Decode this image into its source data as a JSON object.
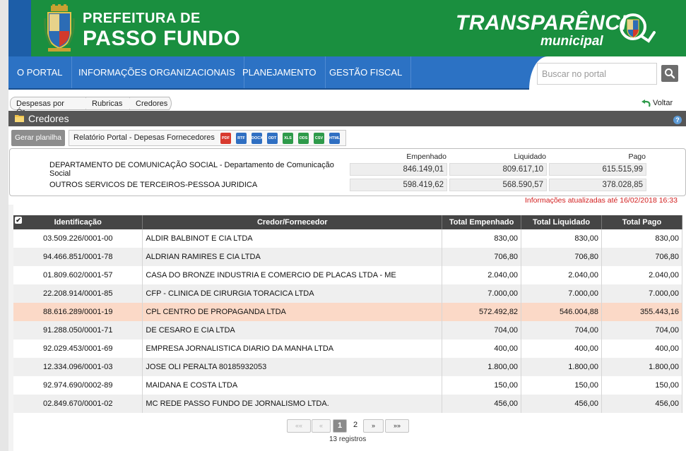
{
  "header": {
    "city_line1": "PREFEITURA DE",
    "city_line2": "PASSO FUNDO",
    "brand_line1": "TRANSPARÊNCI",
    "brand_line2": "municipal",
    "colors": {
      "green": "#1a8f3f",
      "blue": "#1d5ea8",
      "nav": "#2c72c4"
    }
  },
  "nav": {
    "items": [
      "O PORTAL",
      "INFORMAÇÕES ORGANIZACIONAIS",
      "PLANEJAMENTO",
      "GESTÃO FISCAL"
    ],
    "search_placeholder": "Buscar no portal",
    "search_icon": "search-icon"
  },
  "breadcrumb": {
    "items": [
      "Despesas por Ór...",
      "Rubricas",
      "Credores"
    ],
    "back_label": "Voltar"
  },
  "panel": {
    "title": "Credores",
    "help_icon": "help-icon"
  },
  "toolbar": {
    "generate_label": "Gerar planilha",
    "report_label": "Relatório Portal - Depesas Fornecedores",
    "formats": [
      {
        "label": "PDF",
        "color": "#d83a2e"
      },
      {
        "label": "RTF",
        "color": "#2f6fc2"
      },
      {
        "label": "DOCX",
        "color": "#2f6fc2"
      },
      {
        "label": "ODT",
        "color": "#2f6fc2"
      },
      {
        "label": "XLS",
        "color": "#2e9a4a"
      },
      {
        "label": "ODS",
        "color": "#2e9a4a"
      },
      {
        "label": "CSV",
        "color": "#2e9a4a"
      },
      {
        "label": "HTML",
        "color": "#2f6fc2"
      }
    ]
  },
  "summary": {
    "headers": [
      "Empenhado",
      "Liquidado",
      "Pago"
    ],
    "rows": [
      {
        "label": "DEPARTAMENTO DE COMUNICAÇÃO SOCIAL - Departamento de Comunicação Social",
        "empenhado": "846.149,01",
        "liquidado": "809.617,10",
        "pago": "615.515,99"
      },
      {
        "label": "OUTROS SERVICOS DE TERCEIROS-PESSOA JURIDICA",
        "empenhado": "598.419,62",
        "liquidado": "568.590,57",
        "pago": "378.028,85"
      }
    ],
    "updated": "Informações atualizadas até 16/02/2018 16:33"
  },
  "table": {
    "columns": [
      "Identificação",
      "Credor/Fornecedor",
      "Total Empenhado",
      "Total Liquidado",
      "Total Pago"
    ],
    "rows": [
      {
        "id": "03.509.226/0001-00",
        "name": "ALDIR BALBINOT E CIA LTDA",
        "emp": "830,00",
        "liq": "830,00",
        "pago": "830,00"
      },
      {
        "id": "94.466.851/0001-78",
        "name": "ALDRIAN RAMIRES E CIA LTDA",
        "emp": "706,80",
        "liq": "706,80",
        "pago": "706,80"
      },
      {
        "id": "01.809.602/0001-57",
        "name": "CASA DO BRONZE INDUSTRIA E COMERCIO DE PLACAS LTDA - ME",
        "emp": "2.040,00",
        "liq": "2.040,00",
        "pago": "2.040,00"
      },
      {
        "id": "22.208.914/0001-85",
        "name": "CFP - CLINICA DE CIRURGIA TORACICA LTDA",
        "emp": "7.000,00",
        "liq": "7.000,00",
        "pago": "7.000,00"
      },
      {
        "id": "88.616.289/0001-19",
        "name": "CPL CENTRO DE PROPAGANDA LTDA",
        "emp": "572.492,82",
        "liq": "546.004,88",
        "pago": "355.443,16"
      },
      {
        "id": "91.288.050/0001-71",
        "name": "DE CESARO E CIA LTDA",
        "emp": "704,00",
        "liq": "704,00",
        "pago": "704,00"
      },
      {
        "id": "92.029.453/0001-69",
        "name": "EMPRESA JORNALISTICA DIARIO DA MANHA LTDA",
        "emp": "400,00",
        "liq": "400,00",
        "pago": "400,00"
      },
      {
        "id": "12.334.096/0001-03",
        "name": "JOSE OLI PERALTA 80185932053",
        "emp": "1.800,00",
        "liq": "1.800,00",
        "pago": "1.800,00"
      },
      {
        "id": "92.974.690/0002-89",
        "name": "MAIDANA E COSTA LTDA",
        "emp": "150,00",
        "liq": "150,00",
        "pago": "150,00"
      },
      {
        "id": "02.849.670/0001-02",
        "name": "MC REDE PASSO FUNDO DE JORNALISMO LTDA.",
        "emp": "456,00",
        "liq": "456,00",
        "pago": "456,00"
      }
    ]
  },
  "pagination": {
    "first": "««",
    "prev": "«",
    "current": "1",
    "page2": "2",
    "next": "»",
    "last": "»»",
    "count": "13 registros"
  }
}
